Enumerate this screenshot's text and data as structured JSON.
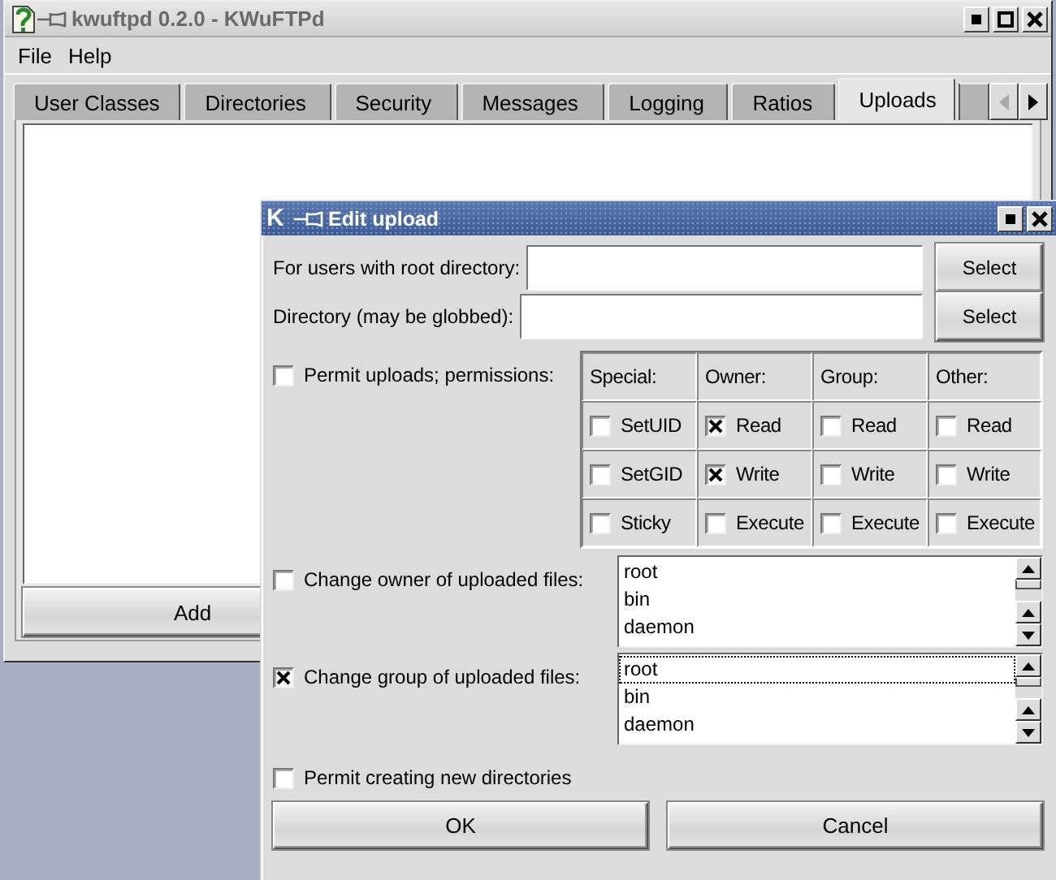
{
  "main_window": {
    "title": "kwuftpd 0.2.0 - KWuFTPd",
    "menu": [
      "File",
      "Help"
    ],
    "tabs": [
      {
        "label": "User Classes",
        "selected": false
      },
      {
        "label": "Directories",
        "selected": false
      },
      {
        "label": "Security",
        "selected": false
      },
      {
        "label": "Messages",
        "selected": false
      },
      {
        "label": "Logging",
        "selected": false
      },
      {
        "label": "Ratios",
        "selected": false
      },
      {
        "label": "Uploads",
        "selected": true
      }
    ],
    "add_button": "Add"
  },
  "dialog": {
    "logo": "K",
    "title": "Edit upload",
    "fields": [
      {
        "label": "For users with root directory:",
        "button": "Select"
      },
      {
        "label": "Directory (may be globbed):",
        "button": "Select"
      }
    ],
    "permit_uploads": {
      "label": "Permit uploads; permissions:",
      "checked": false
    },
    "permissions": {
      "columns": [
        "Special:",
        "Owner:",
        "Group:",
        "Other:"
      ],
      "rows": [
        [
          {
            "label": "SetUID",
            "checked": false
          },
          {
            "label": "Read",
            "checked": true
          },
          {
            "label": "Read",
            "checked": false
          },
          {
            "label": "Read",
            "checked": false
          }
        ],
        [
          {
            "label": "SetGID",
            "checked": false
          },
          {
            "label": "Write",
            "checked": true
          },
          {
            "label": "Write",
            "checked": false
          },
          {
            "label": "Write",
            "checked": false
          }
        ],
        [
          {
            "label": "Sticky",
            "checked": false
          },
          {
            "label": "Execute",
            "checked": false
          },
          {
            "label": "Execute",
            "checked": false
          },
          {
            "label": "Execute",
            "checked": false
          }
        ]
      ]
    },
    "change_owner": {
      "label": "Change owner of uploaded files:",
      "checked": false,
      "items": [
        {
          "text": "root",
          "focused": false
        },
        {
          "text": "bin",
          "focused": false
        },
        {
          "text": "daemon",
          "focused": false
        }
      ]
    },
    "change_group": {
      "label": "Change group of uploaded files:",
      "checked": true,
      "items": [
        {
          "text": "root",
          "focused": true
        },
        {
          "text": "bin",
          "focused": false
        },
        {
          "text": "daemon",
          "focused": false
        }
      ]
    },
    "permit_dirs": {
      "label": "Permit creating new directories",
      "checked": false
    },
    "buttons": [
      "OK",
      "Cancel"
    ]
  }
}
